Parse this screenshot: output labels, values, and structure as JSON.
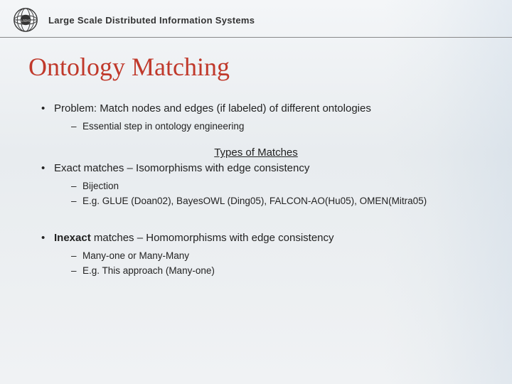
{
  "header": {
    "org_text": "Large Scale Distributed Information Systems"
  },
  "title": "Ontology Matching",
  "bullets": {
    "b1": {
      "text": "Problem: Match nodes and edges (if labeled) of different ontologies",
      "sub1": "Essential step in ontology engineering"
    },
    "section_heading": "Types of Matches",
    "b2": {
      "text": "Exact matches – Isomorphisms with edge consistency",
      "sub1": "Bijection",
      "sub2": "E.g. GLUE (Doan02), BayesOWL (Ding05), FALCON-AO(Hu05), OMEN(Mitra05)"
    },
    "b3": {
      "prefix": "Inexact",
      "suffix": " matches – Homomorphisms with edge consistency",
      "sub1": "Many-one or Many-Many",
      "sub2": "E.g. This approach (Many-one)"
    }
  }
}
